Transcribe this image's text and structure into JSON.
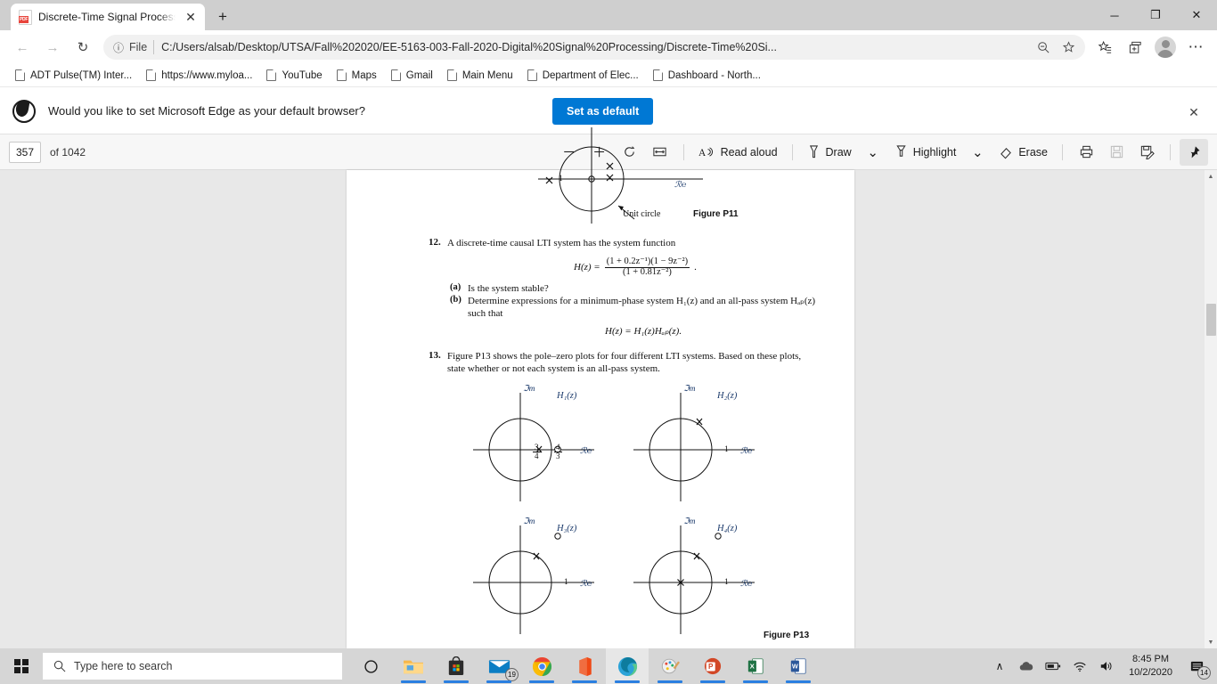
{
  "window": {
    "tab_title": "Discrete-Time Signal Processing",
    "tab_icon": "pdf-file-icon",
    "new_tab_label": "+",
    "minimize_label": "─",
    "restore_label": "❐",
    "close_label": "✕",
    "tab_close_label": "✕"
  },
  "nav": {
    "back_label": "←",
    "forward_label": "→",
    "reload_label": "↻",
    "info_label": "ⓘ",
    "scheme_label": "File",
    "url": "C:/Users/alsab/Desktop/UTSA/Fall%202020/EE-5163-003-Fall-2020-Digital%20Signal%20Processing/Discrete-Time%20Si...",
    "zoom_out_icon": "zoom-out-icon",
    "favorite_icon": "add-favorite-star-icon",
    "favorites_icon": "favorites-hub-icon",
    "collections_icon": "collections-icon",
    "profile_icon": "profile-avatar-icon",
    "settings_icon": "settings-and-more-icon",
    "settings_label": "⋯"
  },
  "bookmarks": [
    {
      "label": "ADT Pulse(TM) Inter...",
      "icon": "page-icon"
    },
    {
      "label": "https://www.myloa...",
      "icon": "page-icon"
    },
    {
      "label": "YouTube",
      "icon": "page-icon"
    },
    {
      "label": "Maps",
      "icon": "page-icon"
    },
    {
      "label": "Gmail",
      "icon": "page-icon"
    },
    {
      "label": "Main Menu",
      "icon": "page-icon"
    },
    {
      "label": "Department of Elec...",
      "icon": "page-icon"
    },
    {
      "label": "Dashboard - North...",
      "icon": "page-icon"
    }
  ],
  "banner": {
    "icon": "edge-logo-icon",
    "message": "Would you like to set Microsoft Edge as your default browser?",
    "button_label": "Set as default",
    "close_label": "✕",
    "accent_color": "#0078d4"
  },
  "pdf_toolbar": {
    "current_page": "357",
    "page_total_label": "of 1042",
    "zoom_out_label": "─",
    "zoom_in_label": "＋",
    "rotate_icon": "rotate-icon",
    "fit_icon": "fit-to-width-icon",
    "read_aloud_label": "Read aloud",
    "read_aloud_icon": "read-aloud-icon",
    "draw_label": "Draw",
    "draw_icon": "pen-icon",
    "draw_chevron": "⌄",
    "highlight_label": "Highlight",
    "highlight_icon": "highlighter-icon",
    "highlight_chevron": "⌄",
    "erase_label": "Erase",
    "erase_icon": "eraser-icon",
    "print_icon": "print-icon",
    "save_icon": "save-icon",
    "save_as_icon": "save-as-icon",
    "pin_icon": "pin-icon"
  },
  "document": {
    "fig_p11_caption": "Figure P11",
    "fig_p11_unit_circle_label": "Unit circle",
    "fig_p11_re_label": "ℛ℮",
    "fig_p11_tick": "1",
    "problem12": {
      "number": "12.",
      "text": "A discrete-time causal LTI system has the system function",
      "equation_lhs": "H(z) =",
      "equation_num": "(1 + 0.2z⁻¹)(1 − 9z⁻²)",
      "equation_den": "(1 + 0.81z⁻²)",
      "part_a_label": "(a)",
      "part_a_text": "Is the system stable?",
      "part_b_label": "(b)",
      "part_b_text": "Determine expressions for a minimum-phase system H₁(z) and an all-pass system Hₐₚ(z)",
      "part_b_text2": "such that",
      "equation_b": "H(z) = H₁(z)Hₐₚ(z)."
    },
    "problem13": {
      "number": "13.",
      "text_line1": "Figure P13 shows the pole–zero plots for four different LTI systems. Based on these plots,",
      "text_line2": "state whether or not each system is an all-pass system.",
      "caption": "Figure P13"
    },
    "plots": [
      {
        "title": "H₁(z)",
        "im_label": "ℑm",
        "re_label": "ℛ℮",
        "tick_labels": [
          "3/4",
          "4/3"
        ],
        "poles": "pole-marker-x",
        "zeros": "zero-marker-o"
      },
      {
        "title": "H₂(z)",
        "im_label": "ℑm",
        "re_label": "ℛ℮",
        "tick_labels": [
          "1"
        ],
        "poles": "pole-marker-x",
        "zeros": ""
      },
      {
        "title": "H₃(z)",
        "im_label": "ℑm",
        "re_label": "ℛ℮",
        "tick_labels": [
          "1"
        ],
        "poles": "pole-marker-x",
        "zeros": "zero-marker-o"
      },
      {
        "title": "H₄(z)",
        "im_label": "ℑm",
        "re_label": "ℛ℮",
        "tick_labels": [
          "1"
        ],
        "poles": "pole-marker-x",
        "zeros": "zero-marker-o"
      }
    ]
  },
  "taskbar": {
    "start_label": "start-button",
    "search_placeholder": "Type here to search",
    "search_icon": "search-icon",
    "cortana_icon": "cortana-icon",
    "items": [
      {
        "name": "file-explorer-icon",
        "label": "File Explorer"
      },
      {
        "name": "microsoft-store-icon",
        "label": "Microsoft Store"
      },
      {
        "name": "mail-icon",
        "label": "Mail",
        "badge": "19"
      },
      {
        "name": "google-chrome-icon",
        "label": "Google Chrome"
      },
      {
        "name": "office-icon",
        "label": "Office"
      },
      {
        "name": "microsoft-edge-icon",
        "label": "Microsoft Edge"
      },
      {
        "name": "paint-icon",
        "label": "Paint 3D"
      },
      {
        "name": "powerpoint-icon",
        "label": "PowerPoint"
      },
      {
        "name": "excel-icon",
        "label": "Excel"
      },
      {
        "name": "word-icon",
        "label": "Word"
      }
    ],
    "tray": {
      "chevron_label": "∧",
      "onedrive_icon": "onedrive-icon",
      "battery_icon": "battery-icon",
      "wifi_icon": "wifi-icon",
      "volume_icon": "volume-icon",
      "time": "8:45 PM",
      "date": "10/2/2020",
      "notification_icon": "notification-center-icon",
      "notification_count": "14"
    }
  }
}
